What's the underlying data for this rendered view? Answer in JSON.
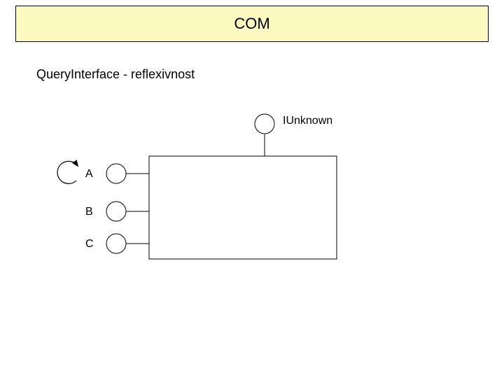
{
  "title": "COM",
  "subtitle": "QueryInterface - reflexivnost",
  "iunknown_label": "IUnknown",
  "interfaces": {
    "a": "A",
    "b": "B",
    "c": "C"
  }
}
